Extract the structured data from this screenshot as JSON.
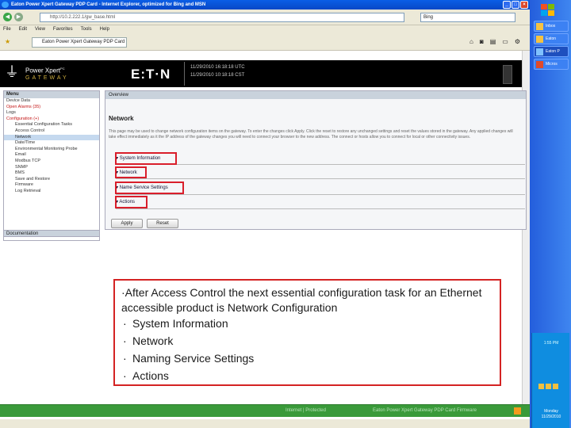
{
  "browser": {
    "title": "Eaton Power Xpert Gateway PDP Card - Internet Explorer, optimized for Bing and MSN",
    "url": "http://10.2.222.1/gw_base.html",
    "search_value": "Bing",
    "menu": [
      "File",
      "Edit",
      "View",
      "Favorites",
      "Tools",
      "Help"
    ],
    "tab_label": "Eaton Power Xpert Gateway PDP Card",
    "toolbar_icons": [
      "home-icon",
      "feeds-icon",
      "print-icon",
      "page-icon",
      "tools-icon"
    ]
  },
  "banner": {
    "product_line1": "Power Xpert",
    "product_sup": "PC",
    "product_line2": "GATEWAY",
    "logo": "E:T·N",
    "datetime1": "11/29/2010 16:18:18 UTC",
    "datetime2": "11/29/2010 10:18:18 CST"
  },
  "left_menu": {
    "header": "Menu",
    "items": [
      {
        "label": "Device Data",
        "style": ""
      },
      {
        "label": "Open Alarms (35)",
        "style": "red"
      },
      {
        "label": "Logs",
        "style": ""
      },
      {
        "label": "Configuration (+)",
        "style": "red"
      },
      {
        "label": "Essential Configuration Tasks",
        "style": "sub"
      },
      {
        "label": "Access Control",
        "style": "sub"
      },
      {
        "label": "Network",
        "style": "sub sel"
      },
      {
        "label": "Date/Time",
        "style": "sub"
      },
      {
        "label": "Environmental Monitoring Probe",
        "style": "sub"
      },
      {
        "label": "Email",
        "style": "sub"
      },
      {
        "label": "Modbus TCP",
        "style": "sub"
      },
      {
        "label": "SNMP",
        "style": "sub"
      },
      {
        "label": "BMS",
        "style": "sub"
      },
      {
        "label": "Save and Restore",
        "style": "sub"
      },
      {
        "label": "Firmware",
        "style": "sub"
      },
      {
        "label": "Log Retrieval",
        "style": "sub"
      }
    ],
    "documentation": "Documentation"
  },
  "overview": {
    "header": "Overview",
    "title": "Network",
    "description": "This page may be used to change network configuration items on the gateway. To enter the changes click Apply. Click the reset to restore any unchanged settings and reset the values stored in the gateway. Any applied changes will take effect immediately as it the IP address of the gateway changes you will need to connect your browser to the new address. The connect or hosts allow you to connect for local or other connectivity issues.",
    "sections": [
      "System Information",
      "Network",
      "Name Service Settings",
      "Actions"
    ],
    "apply_label": "Apply",
    "reset_label": "Reset"
  },
  "note": {
    "intro": "After Access Control the next essential configuration task for an Ethernet accessible product is Network Configuration",
    "bullets": [
      "System Information",
      "Network",
      "Naming Service Settings",
      "Actions"
    ]
  },
  "status_bar": {
    "left": "Internet | Protected",
    "right": "Eaton Power Xpert Gateway PDP Card Firmware"
  },
  "taskbar_right": {
    "buttons": [
      "Inbox",
      "Eaton",
      "Eaton P",
      "Micros"
    ],
    "time": "1:55 PM",
    "date": "Monday 11/29/2010"
  },
  "colors": {
    "highlight": "#d91e2b",
    "banner_bg": "#000000",
    "status_green": "#3a9a3a"
  }
}
